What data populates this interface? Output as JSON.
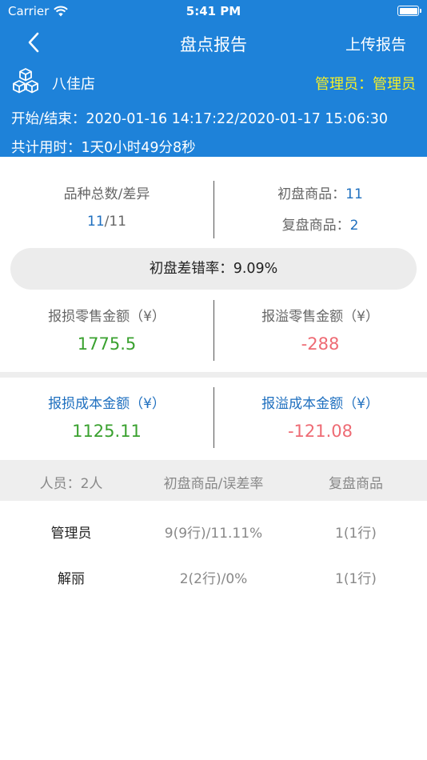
{
  "status_bar": {
    "carrier": "Carrier",
    "time": "5:41 PM"
  },
  "nav": {
    "title": "盘点报告",
    "upload_label": "上传报告"
  },
  "store": {
    "name": "八佳店",
    "admin_label": "管理员：管理员"
  },
  "times": {
    "start_end": "开始/结束：2020-01-16 14:17:22/2020-01-17 15:06:30",
    "total": "共计用时：1天0小时49分8秒"
  },
  "summary": {
    "variety_label": "品种总数/差异",
    "variety_total": "11",
    "variety_diff": "/11",
    "first_label": "初盘商品：",
    "first_value": "11",
    "second_label": "复盘商品：",
    "second_value": "2"
  },
  "error_rate": {
    "label": "初盘差错率：",
    "value": "9.09%"
  },
  "retail": {
    "loss_label": "报损零售金额（¥）",
    "loss_value": "1775.5",
    "overflow_label": "报溢零售金额（¥）",
    "overflow_value": "-288"
  },
  "cost": {
    "loss_label": "报损成本金额（¥）",
    "loss_value": "1125.11",
    "overflow_label": "报溢成本金额（¥）",
    "overflow_value": "-121.08"
  },
  "staff_table": {
    "headers": [
      "人员：2人",
      "初盘商品/误差率",
      "复盘商品"
    ],
    "rows": [
      {
        "name": "管理员",
        "first": "9(9行)/11.11%",
        "second": "1(1行)"
      },
      {
        "name": "解丽",
        "first": "2(2行)/0%",
        "second": "1(1行)"
      }
    ]
  },
  "colors": {
    "header_blue": "#1e82d9",
    "admin_yellow": "#f5ef27",
    "green": "#3aa12f",
    "red": "#ee6b74",
    "link_blue": "#1e6fbf"
  },
  "icons": {
    "back": "chevron-left-icon",
    "store": "cubes-icon",
    "wifi": "wifi-icon",
    "battery": "battery-icon"
  }
}
